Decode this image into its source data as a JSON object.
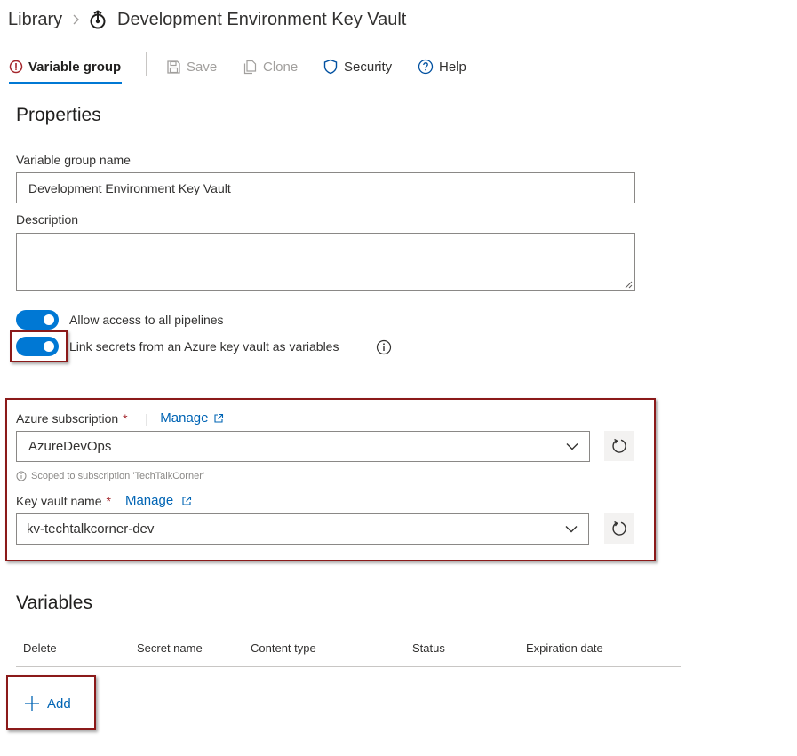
{
  "breadcrumb": {
    "root": "Library",
    "title": "Development Environment Key Vault"
  },
  "toolbar": {
    "tabs": [
      {
        "label": "Variable group",
        "icon": "error-circle-icon",
        "active": true
      },
      {
        "label": "Save",
        "icon": "save-icon",
        "disabled": true
      },
      {
        "label": "Clone",
        "icon": "clone-icon",
        "disabled": true
      },
      {
        "label": "Security",
        "icon": "shield-icon"
      },
      {
        "label": "Help",
        "icon": "help-icon"
      }
    ]
  },
  "properties": {
    "heading": "Properties",
    "name_label": "Variable group name",
    "name_value": "Development Environment Key Vault",
    "description_label": "Description",
    "description_value": "",
    "toggles": [
      {
        "label": "Allow access to all pipelines",
        "on": true
      },
      {
        "label": "Link secrets from an Azure key vault as variables",
        "on": true
      }
    ]
  },
  "keyvault": {
    "subscription_label": "Azure subscription",
    "required_mark": "*",
    "divider": "|",
    "manage_label": "Manage",
    "subscription_value": "AzureDevOps",
    "scope_note": "Scoped to subscription 'TechTalkCorner'",
    "vault_label": "Key vault name",
    "vault_value": "kv-techtalkcorner-dev"
  },
  "variables": {
    "heading": "Variables",
    "columns": [
      "Delete",
      "Secret name",
      "Content type",
      "Status",
      "Expiration date"
    ],
    "add_label": "Add"
  },
  "colors": {
    "accent": "#0078d4",
    "link": "#0064b4",
    "highlight": "#8b1a1a",
    "error": "#a4262c"
  }
}
